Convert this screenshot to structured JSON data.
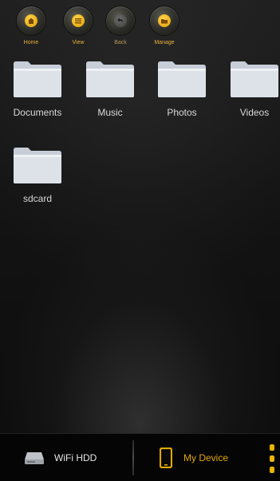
{
  "toolbar": {
    "items": [
      {
        "label": "Home",
        "icon": "home-icon"
      },
      {
        "label": "View",
        "icon": "list-view-icon"
      },
      {
        "label": "Back",
        "icon": "back-arrow-icon"
      },
      {
        "label": "Manage",
        "icon": "folder-manage-icon"
      }
    ]
  },
  "folders": [
    {
      "name": "Documents"
    },
    {
      "name": "Music"
    },
    {
      "name": "Photos"
    },
    {
      "name": "Videos"
    },
    {
      "name": "sdcard"
    }
  ],
  "bottom_bar": {
    "wifi_label": "WiFi HDD",
    "device_label": "My Device"
  },
  "colors": {
    "accent": "#e0a800",
    "background": "#141414",
    "folder": "#d4dae2"
  }
}
